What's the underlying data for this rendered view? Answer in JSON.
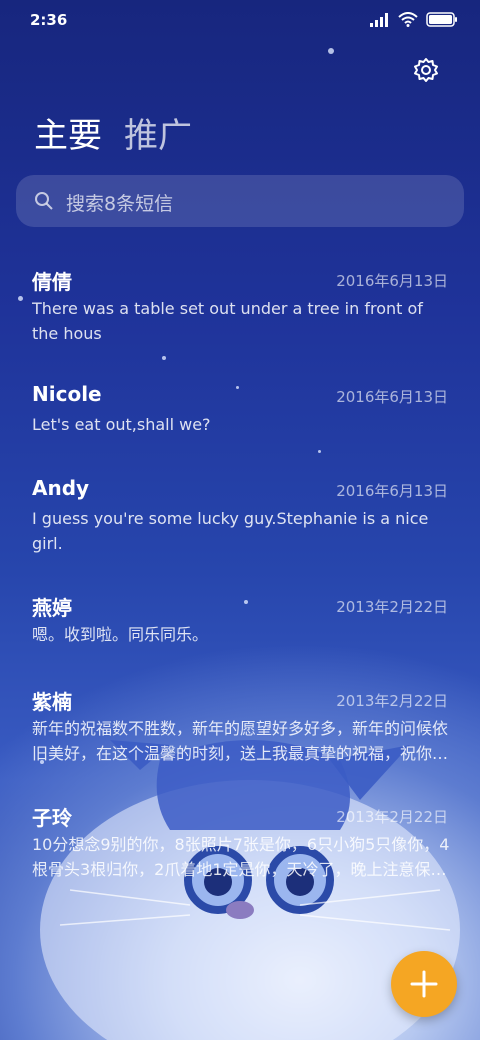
{
  "status_bar": {
    "time": "2:36"
  },
  "header": {
    "tabs": [
      {
        "label": "主要"
      },
      {
        "label": "推广"
      }
    ]
  },
  "search": {
    "placeholder": "搜索8条短信"
  },
  "conversations": [
    {
      "name": "倩倩",
      "date": "2016年6月13日",
      "preview": "There was a table set out under a tree in front of the hous"
    },
    {
      "name": "Nicole",
      "date": "2016年6月13日",
      "preview": "Let's eat out,shall we?"
    },
    {
      "name": "Andy",
      "date": "2016年6月13日",
      "preview": "I guess you're some lucky guy.Stephanie is a nice girl."
    },
    {
      "name": "燕婷",
      "date": "2013年2月22日",
      "preview": "嗯。收到啦。同乐同乐。"
    },
    {
      "name": "紫楠",
      "date": "2013年2月22日",
      "preview": "新年的祝福数不胜数，新年的愿望好多好多，新年的问候依旧美好，在这个温馨的时刻，送上我最真挚的祝福，祝你新年快乐！"
    },
    {
      "name": "子玲",
      "date": "2013年2月22日",
      "preview": "10分想念9别的你，8张照片7张是你，6只小狗5只像你，4根骨头3根归你，2爪着地1定是你，天冷了，晚上注意保暖哦！"
    }
  ],
  "fab": {
    "icon": "plus-icon",
    "color": "#f5a623"
  }
}
